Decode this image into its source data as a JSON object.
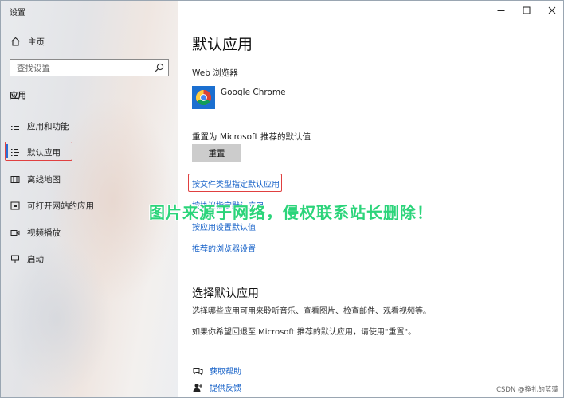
{
  "window": {
    "title": "设置"
  },
  "sidebar": {
    "home_label": "主页",
    "search_placeholder": "查找设置",
    "section_title": "应用",
    "items": [
      {
        "label": "应用和功能",
        "icon": "list-icon"
      },
      {
        "label": "默认应用",
        "icon": "default-apps-icon",
        "selected": true
      },
      {
        "label": "离线地图",
        "icon": "map-icon"
      },
      {
        "label": "可打开网站的应用",
        "icon": "open-website-icon"
      },
      {
        "label": "视频播放",
        "icon": "video-icon"
      },
      {
        "label": "启动",
        "icon": "startup-icon"
      }
    ]
  },
  "main": {
    "page_title": "默认应用",
    "browser_label": "Web 浏览器",
    "browser_name": "Google Chrome",
    "reset_label": "重置为 Microsoft 推荐的默认值",
    "reset_button": "重置",
    "links": [
      "按文件类型指定默认应用",
      "按协议指定默认应用",
      "按应用设置默认值",
      "推荐的浏览器设置"
    ],
    "section2_title": "选择默认应用",
    "section2_desc1": "选择哪些应用可用来聆听音乐、查看图片、检查邮件、观看视频等。",
    "section2_desc2": "如果你希望回退至 Microsoft 推荐的默认应用，请使用\"重置\"。",
    "help_link": "获取帮助",
    "feedback_link": "提供反馈"
  },
  "overlay": {
    "watermark": "图片来源于网络，侵权联系站长删除！",
    "credit": "CSDN @挣扎的蓝藻"
  },
  "colors": {
    "accent": "#1762c8",
    "highlight_box": "#e04040",
    "watermark": "#2bd47a",
    "button_bg": "#cccccc"
  }
}
